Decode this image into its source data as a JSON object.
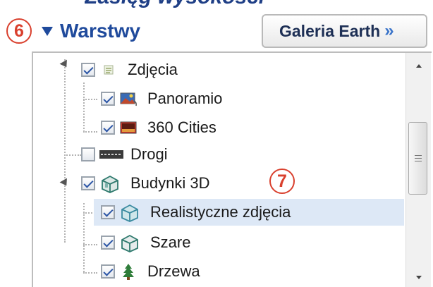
{
  "top_crop_text": "Zasięg wysokości",
  "callouts": {
    "c1": "6",
    "c2": "7"
  },
  "layers": {
    "title": "Warstwy"
  },
  "gallery_button": {
    "label": "Galeria Earth",
    "chevron": "»"
  },
  "tree": {
    "items": [
      {
        "label": "Zdjęcia",
        "checked": true,
        "icon": "photos-layer-icon"
      },
      {
        "label": "Panoramio",
        "checked": true,
        "icon": "panoramio-photo-icon"
      },
      {
        "label": "360 Cities",
        "checked": true,
        "icon": "360-cities-photo-icon"
      },
      {
        "label": "Drogi",
        "checked": false,
        "icon": "roads-icon"
      },
      {
        "label": "Budynki 3D",
        "checked": true,
        "icon": "3d-buildings-icon"
      },
      {
        "label": "Realistyczne zdjęcia",
        "checked": true,
        "icon": "realistic-building-icon",
        "selected": true
      },
      {
        "label": "Szare",
        "checked": true,
        "icon": "gray-building-icon"
      },
      {
        "label": "Drzewa",
        "checked": true,
        "icon": "tree-icon"
      }
    ]
  },
  "colors": {
    "accent": "#1f4a9c",
    "callout": "#d9402e",
    "selection": "#dde8f6"
  }
}
